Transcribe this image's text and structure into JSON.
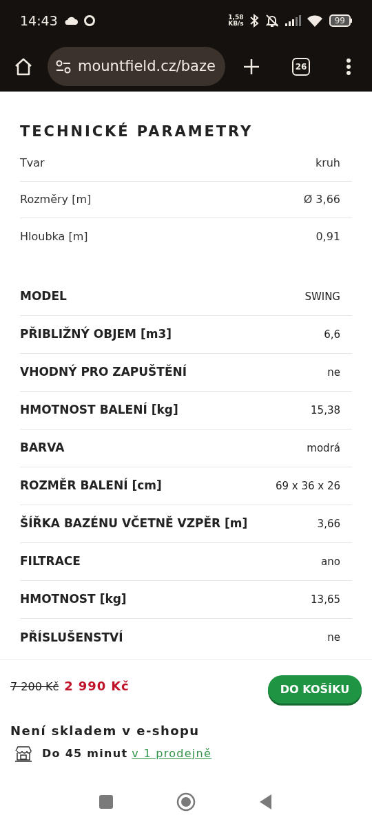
{
  "status_bar": {
    "time": "14:43",
    "net_speed": "1,58",
    "net_unit": "KB/s",
    "battery": "99"
  },
  "browser": {
    "url": "mountfield.cz/baze",
    "tab_count": "26"
  },
  "title": "TECHNICKÉ PARAMETRY",
  "basic_params": [
    {
      "label": "Tvar",
      "value": "kruh"
    },
    {
      "label": "Rozměry [m]",
      "value": "Ø 3,66"
    },
    {
      "label": "Hloubka [m]",
      "value": "0,91"
    }
  ],
  "params": [
    {
      "label": "MODEL",
      "value": "SWING"
    },
    {
      "label": "PŘIBLIŽNÝ OBJEM [m3]",
      "value": "6,6"
    },
    {
      "label": "VHODNÝ PRO ZAPUŠTĚNÍ",
      "value": "ne"
    },
    {
      "label": "HMOTNOST BALENÍ [kg]",
      "value": "15,38"
    },
    {
      "label": "BARVA",
      "value": "modrá"
    },
    {
      "label": "ROZMĚR BALENÍ [cm]",
      "value": "69 x 36 x 26"
    },
    {
      "label": "ŠÍŘKA BAZÉNU VČETNĚ VZPĚR [m]",
      "value": "3,66"
    },
    {
      "label": "FILTRACE",
      "value": "ano"
    },
    {
      "label": "HMOTNOST [kg]",
      "value": "13,65"
    },
    {
      "label": "PŘÍSLUŠENSTVÍ",
      "value": "ne"
    }
  ],
  "cart_bar": {
    "old_price": "7 200 Kč",
    "price": "2 990 Kč",
    "button": "DO KOŠÍKU",
    "stock": "Není skladem v e-shopu",
    "pickup": "Do 45 minut",
    "pickup_link": "v 1 prodejně"
  }
}
